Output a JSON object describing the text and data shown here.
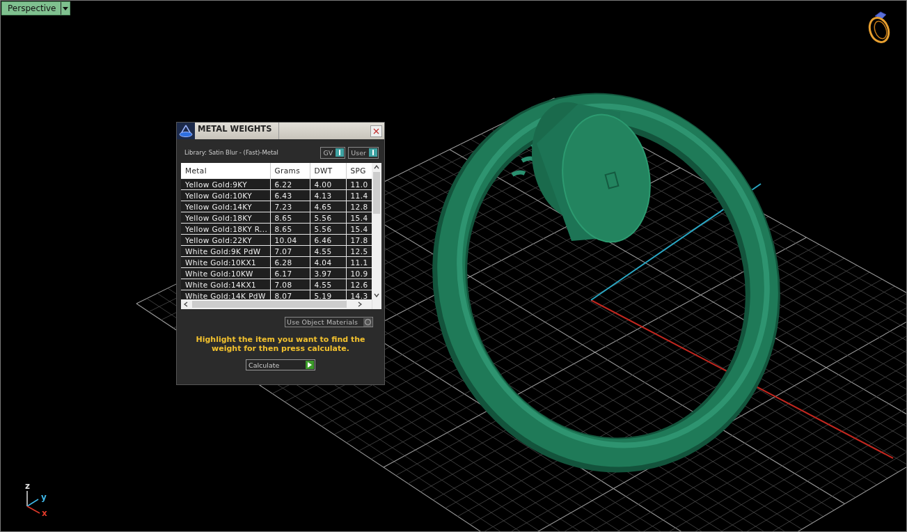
{
  "viewport": {
    "view_menu": {
      "label": "Perspective"
    },
    "axes": [
      {
        "label": "z",
        "color": "#e0e0e0"
      },
      {
        "label": "y",
        "color": "#3fb8e8"
      },
      {
        "label": "x",
        "color": "#e03a2a"
      }
    ]
  },
  "dialog": {
    "title": "METAL WEIGHTS",
    "library": "Library: Satin Blur - (Fast)-Metal",
    "toggles": [
      {
        "label": "GV",
        "on": true
      },
      {
        "label": "User",
        "on": true
      }
    ],
    "table": {
      "columns": [
        "Metal",
        "Grams",
        "DWT",
        "SPG"
      ],
      "rows": [
        {
          "cells": [
            "Yellow Gold:9KY",
            "6.22",
            "4.00",
            "11.0"
          ],
          "selected": false
        },
        {
          "cells": [
            "Yellow Gold:10KY",
            "6.43",
            "4.13",
            "11.4"
          ],
          "selected": false
        },
        {
          "cells": [
            "Yellow Gold:14KY",
            "7.23",
            "4.65",
            "12.8"
          ],
          "selected": false
        },
        {
          "cells": [
            "Yellow Gold:18KY",
            "8.65",
            "5.56",
            "15.4"
          ],
          "selected": false
        },
        {
          "cells": [
            "Yellow Gold:18KY R...",
            "8.65",
            "5.56",
            "15.4"
          ],
          "selected": false
        },
        {
          "cells": [
            "Yellow Gold:22KY",
            "10.04",
            "6.46",
            "17.8"
          ],
          "selected": false
        },
        {
          "cells": [
            "White Gold:9K PdW",
            "7.07",
            "4.55",
            "12.5"
          ],
          "selected": false
        },
        {
          "cells": [
            "White Gold:10KX1",
            "6.28",
            "4.04",
            "11.1"
          ],
          "selected": false
        },
        {
          "cells": [
            "White Gold:10KW",
            "6.17",
            "3.97",
            "10.9"
          ],
          "selected": false
        },
        {
          "cells": [
            "White Gold:14KX1",
            "7.08",
            "4.55",
            "12.6"
          ],
          "selected": false
        },
        {
          "cells": [
            "White Gold:14K PdW",
            "8.07",
            "5.19",
            "14.3"
          ],
          "selected": false
        }
      ]
    },
    "materials_toggle": {
      "label": "Use Object Materials",
      "on": false
    },
    "hint": "Highlight the item you want to find the weight for then press calculate.",
    "calculate_button": {
      "label": "Calculate"
    }
  }
}
